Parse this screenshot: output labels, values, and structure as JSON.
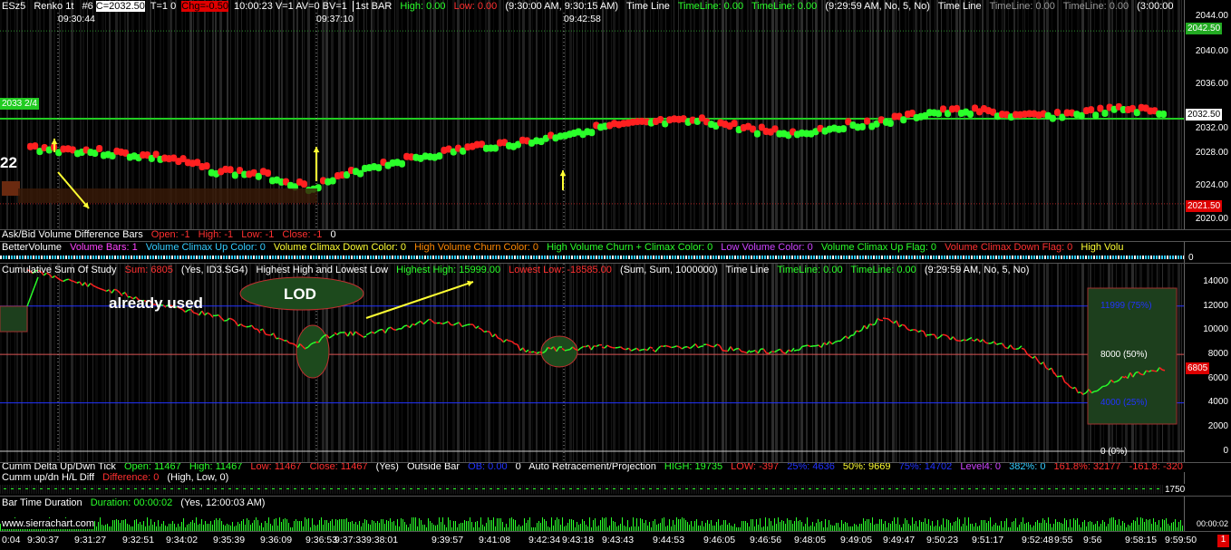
{
  "colors": {
    "up": "#2aff2a",
    "down": "#ff2020",
    "bg": "#000000",
    "hline": "#22cc22",
    "blue": "#2233ff",
    "yellow": "#ffff33"
  },
  "main": {
    "symbol": "ESz5",
    "chart_type": "Renko 1t",
    "chart_no": "#6",
    "close_box": "C=2032.50",
    "t_field": "T=1 0",
    "change_box": "Chg=-0.50",
    "info": "10:00:23 V=1 AV=0 BV=1",
    "bar_label": "1st BAR",
    "high": "High: 0.00",
    "low": "Low: 0.00",
    "session": "(9:30:00 AM, 9:30:15 AM)",
    "tl1": "Time Line",
    "tl2": "TimeLine: 0.00",
    "tl3": "TimeLine: 0.00",
    "tl4": "(9:29:59 AM, No, 5, No)",
    "tl5": "Time Line",
    "tl6": "TimeLine: 0.00",
    "tl7": "TimeLine: 0.00",
    "tl8": "(3:00:00",
    "vtimes": [
      "09:30:44",
      "09:37:10",
      "09:42:58"
    ],
    "left_level": "2033 2/4",
    "side_number": "22",
    "price_ticks": [
      "2044.00",
      "2040.00",
      "2036.00",
      "2032.00",
      "2028.00",
      "2024.00",
      "2020.00"
    ],
    "price_boxes": {
      "top": "2042.50",
      "last": "2032.50",
      "bottom": "2021.50"
    }
  },
  "p2": {
    "name": "Ask/Bid Volume Difference Bars",
    "open": "Open: -1",
    "high": "High: -1",
    "low": "Low: -1",
    "close": "Close: -1",
    "tail": "0"
  },
  "p3": {
    "name": "BetterVolume",
    "items": [
      "Volume Bars: 1",
      "Volume Climax Up Color: 0",
      "Volume Climax Down Color: 0",
      "High Volume Churn Color: 0",
      "High Volume Churn + Climax Color: 0",
      "Low Volume Color: 0",
      "Volume Climax Up Flag: 0",
      "Volume Climax Down Flag: 0",
      "High Volu"
    ],
    "scale": "0"
  },
  "p4": {
    "name": "Cumulative Sum Of Study",
    "sum": "Sum: 6805",
    "args": "(Yes, ID3.SG4)",
    "hl": "Highest High and Lowest Low",
    "hh": "Highest High: 15999.00",
    "ll": "Lowest Low: -18585.00",
    "args2": "(Sum, Sum, 1000000)",
    "tl": "Time Line",
    "tl1": "TimeLine: 0.00",
    "tl2": "TimeLine: 0.00",
    "tl3": "(9:29:59 AM, No, 5, No)",
    "already": "already used",
    "lod": "LOD",
    "ticks": [
      "14000",
      "12000",
      "10000",
      "8000",
      "6000",
      "4000",
      "2000",
      "0"
    ],
    "lvl75": "11999  (75%)",
    "lvl50": "8000  (50%)",
    "lvl25": "4000  (25%)",
    "lvl0": "0  (0%)",
    "last": "6805"
  },
  "p5": {
    "name": "Cumm Delta Up/Dwn Tick",
    "open": "Open: 11467",
    "high": "High: 11467",
    "low": "Low: 11467",
    "close": "Close: 11467",
    "yes": "(Yes)",
    "ob": "Outside Bar",
    "ob2": "OB: 0.00",
    "zero": "0",
    "art": "Auto Retracement/Projection",
    "hi": "HIGH: 19735",
    "lo": "LOW: -397",
    "p25": "25%: 4636",
    "p50": "50%: 9669",
    "p75": "75%: 14702",
    "lvl4": "Level4: 0",
    "p382": "382%: 0",
    "p1618": "161.8%: 32177",
    "pm1618": "-161.8: -320"
  },
  "p6": {
    "name": "Cumm up/dn H/L Diff",
    "diff": "Difference: 0",
    "args": "(High, Low, 0)",
    "value": "1750"
  },
  "p7": {
    "name": "Bar Time Duration",
    "dur": "Duration: 00:00:02",
    "args": "(Yes, 12:00:03 AM)",
    "scale": "00:00:02"
  },
  "footer": {
    "site": "www.sierrachart.com",
    "times": [
      "0:04",
      "9:30:37",
      "9:31:27",
      "9:32:51",
      "9:34:02",
      "9:35:39",
      "9:36:09",
      "9:36:53",
      "9:37:33",
      "9:38:01",
      "9:39:57",
      "9:41:08",
      "9:42:34",
      "9:43:18",
      "9:43:43",
      "9:44:53",
      "9:46:05",
      "9:46:56",
      "9:48:05",
      "9:49:05",
      "9:49:47",
      "9:50:23",
      "9:51:17",
      "9:52:48",
      "9:55",
      "9:56",
      "9:58:15",
      "9:59:50"
    ]
  },
  "chart_data": {
    "type": "line",
    "price_series": {
      "x_time": [
        "9:30:37",
        "9:31:27",
        "9:32:51",
        "9:34:02",
        "9:35:39",
        "9:36:09",
        "9:36:53",
        "9:37:33",
        "9:38:01",
        "9:39:57",
        "9:41:08",
        "9:42:34",
        "9:43:18",
        "9:43:43",
        "9:44:53",
        "9:46:05",
        "9:46:56",
        "9:48:05",
        "9:49:05",
        "9:49:47",
        "9:50:23",
        "9:51:17",
        "9:52:48",
        "9:55",
        "9:56",
        "9:58:15",
        "9:59:50"
      ],
      "y": [
        2028.3,
        2028.0,
        2027.5,
        2027.0,
        2025.5,
        2025.0,
        2023.5,
        2024.5,
        2026.0,
        2027.5,
        2028.5,
        2029.0,
        2030.0,
        2030.8,
        2031.3,
        2031.5,
        2030.5,
        2030.0,
        2031.0,
        2031.5,
        2032.5,
        2032.8,
        2032.0,
        2032.3,
        2032.5,
        2033.0,
        2032.5
      ]
    },
    "cumsum_series": {
      "x_time": [
        "9:30:37",
        "9:31:27",
        "9:32:51",
        "9:34:02",
        "9:35:39",
        "9:36:09",
        "9:36:53",
        "9:37:33",
        "9:38:01",
        "9:39:57",
        "9:41:08",
        "9:42:34",
        "9:43:18",
        "9:43:43",
        "9:44:53",
        "9:46:05",
        "9:46:56",
        "9:48:05",
        "9:49:05",
        "9:49:47",
        "9:50:23",
        "9:51:17",
        "9:52:48",
        "9:55",
        "9:56",
        "9:58:15",
        "9:59:50"
      ],
      "y": [
        15000,
        14000,
        13000,
        12000,
        11200,
        10000,
        8500,
        9800,
        9600,
        10800,
        10200,
        8200,
        8500,
        8600,
        8400,
        8800,
        8200,
        8300,
        9100,
        11000,
        9600,
        9200,
        8500,
        6500,
        4700,
        6200,
        6805
      ]
    }
  }
}
